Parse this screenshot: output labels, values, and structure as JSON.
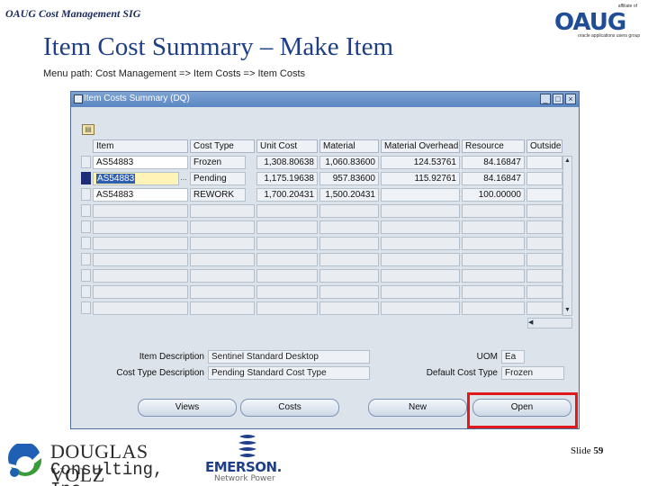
{
  "slide": {
    "sig": "OAUG Cost Management SIG",
    "title": "Item Cost Summary – Make Item",
    "menu_path": "Menu path:  Cost Management => Item Costs  => Item Costs",
    "slide_label": "Slide",
    "slide_number": "59"
  },
  "logos": {
    "oaug_affiliate": "affiliate of",
    "oaug_word": "OAUG",
    "oaug_tag": "oracle applications users group",
    "douglas_volz_name": "DOUGLAS VOLZ",
    "douglas_volz_sub": "Consulting, Inc.",
    "emerson_name": "EMERSON.",
    "emerson_sub": "Network Power"
  },
  "window": {
    "title": "Item Costs Summary (DQ)",
    "columns": [
      "Item",
      "Cost Type",
      "Unit Cost",
      "Material",
      "Material Overhead",
      "Resource",
      "Outside P"
    ],
    "rows": [
      {
        "item": "AS54883",
        "cost_type": "Frozen",
        "unit_cost": "1,308.80638",
        "material": "1,060.83600",
        "material_overhead": "124.53761",
        "resource": "84.16847",
        "outside": ""
      },
      {
        "item": "AS54883",
        "cost_type": "Pending",
        "unit_cost": "1,175.19638",
        "material": "957.83600",
        "material_overhead": "115.92761",
        "resource": "84.16847",
        "outside": ""
      },
      {
        "item": "AS54883",
        "cost_type": "REWORK",
        "unit_cost": "1,700.20431",
        "material": "1,500.20431",
        "material_overhead": "",
        "resource": "100.00000",
        "outside": ""
      }
    ],
    "empty_row_count": 7,
    "item_description_label": "Item Description",
    "item_description": "Sentinel Standard Desktop",
    "cost_type_description_label": "Cost Type Description",
    "cost_type_description": "Pending Standard Cost Type",
    "uom_label": "UOM",
    "uom": "Ea",
    "default_cost_type_label": "Default Cost Type",
    "default_cost_type": "Frozen",
    "buttons": {
      "views": "Views",
      "costs": "Costs",
      "new": "New",
      "open": "Open"
    },
    "colors": {
      "title_bar": "#5a86c2",
      "selected_row": "#1d2d7a",
      "highlight_field": "#fff3b8",
      "callout_box": "#e01a1a"
    }
  }
}
